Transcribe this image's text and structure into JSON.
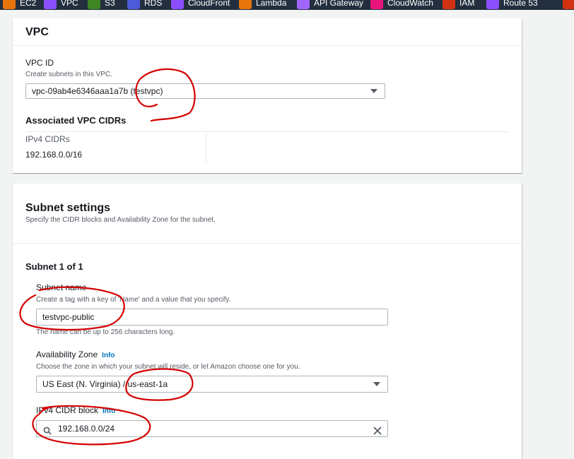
{
  "topbar": {
    "services": [
      {
        "label": "EC2",
        "color": "#e8750b"
      },
      {
        "label": "VPC",
        "color": "#8c4fff"
      },
      {
        "label": "S3",
        "color": "#3f8624"
      },
      {
        "label": "RDS",
        "color": "#4d5bd9"
      },
      {
        "label": "CloudFront",
        "color": "#8c4fff"
      },
      {
        "label": "Lambda",
        "color": "#e8750b"
      },
      {
        "label": "API Gateway",
        "color": "#a166ff"
      },
      {
        "label": "CloudWatch",
        "color": "#e7157b"
      },
      {
        "label": "IAM",
        "color": "#d13212"
      },
      {
        "label": "Route 53",
        "color": "#8c4fff"
      },
      {
        "label": "",
        "color": "#d13212"
      }
    ]
  },
  "vpc_panel": {
    "title": "VPC",
    "vpc_id_label": "VPC ID",
    "vpc_id_desc": "Create subnets in this VPC.",
    "vpc_id_value": "vpc-09ab4e6346aaa1a7b (testvpc)",
    "assoc_title": "Associated VPC CIDRs",
    "ipv4_label": "IPv4 CIDRs",
    "ipv4_value": "192.168.0.0/16"
  },
  "subnet_panel": {
    "title": "Subnet settings",
    "desc": "Specify the CIDR blocks and Availability Zone for the subnet.",
    "subnet_heading": "Subnet 1 of 1",
    "name_label": "Subnet name",
    "name_desc": "Create a tag with a key of 'Name' and a value that you specify.",
    "name_value": "testvpc-public",
    "name_hint": "The name can be up to 256 characters long.",
    "az_label": "Availability Zone",
    "az_info": "Info",
    "az_desc": "Choose the zone in which your subnet will reside, or let Amazon choose one for you.",
    "az_value": "US East (N. Virginia) / us-east-1a",
    "cidr_label": "IPv4 CIDR block",
    "cidr_info": "Info",
    "cidr_value": "192.168.0.0/24"
  },
  "annotation_color": "#d40000"
}
